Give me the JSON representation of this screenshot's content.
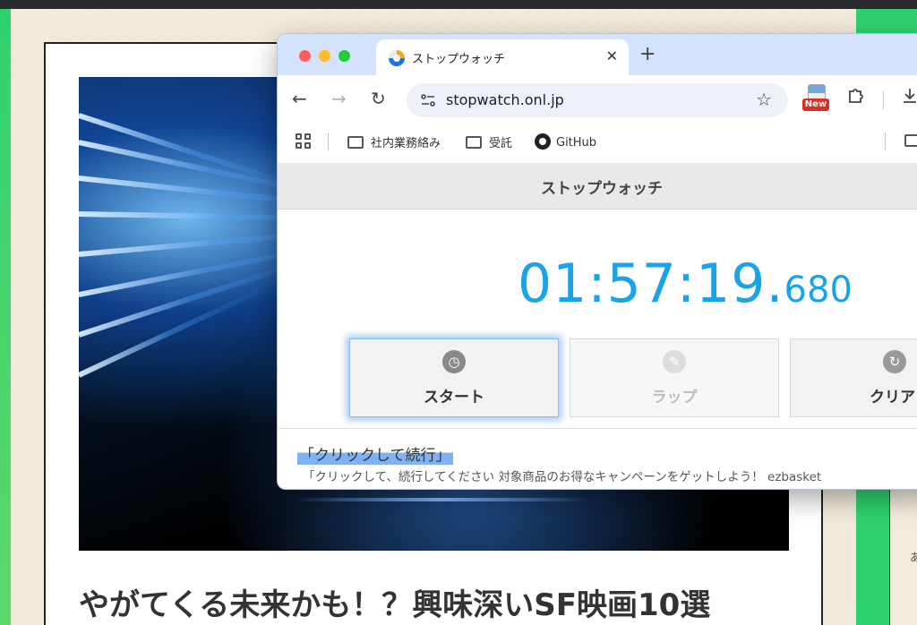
{
  "background": {
    "article_title": "やがてくる未来かも！？興味深いSF映画10選",
    "side_text": "あ"
  },
  "browser": {
    "tab": {
      "title": "ストップウォッチ",
      "close": "✕"
    },
    "new_tab": "+",
    "url": "stopwatch.onl.jp",
    "ext_badge": "New",
    "bookmarks": [
      {
        "label": "社内業務絡み",
        "type": "folder"
      },
      {
        "label": "受託",
        "type": "folder"
      },
      {
        "label": "GitHub",
        "type": "github"
      }
    ]
  },
  "app": {
    "title": "ストップウォッチ",
    "time_main": "01:57:19.",
    "time_ms": "680",
    "buttons": {
      "start": "スタート",
      "lap": "ラップ",
      "clear": "クリア"
    }
  },
  "ad": {
    "title": "「クリックして続行」",
    "description": "「クリックして、続行してください 対象商品のお得なキャンペーンをゲットしよう！ ezbasket"
  },
  "colors": {
    "timer": "#1aa3e8",
    "tabbar": "#d3e3fd",
    "page_green": "#2fd16f"
  }
}
